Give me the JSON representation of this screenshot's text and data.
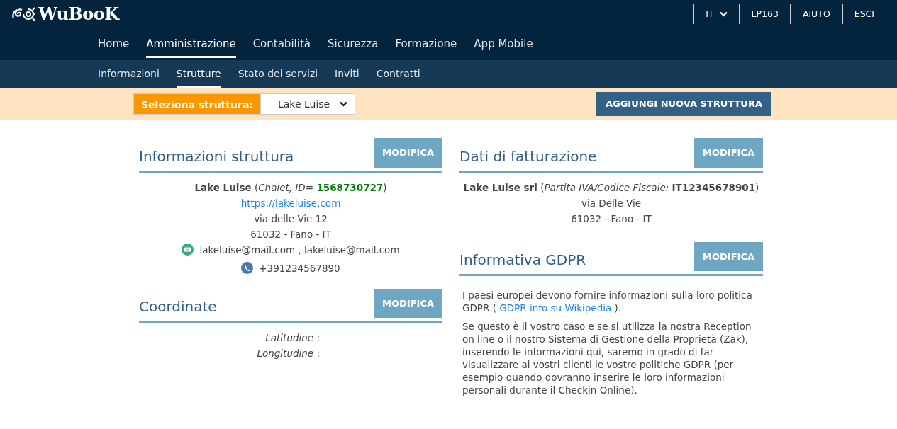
{
  "header": {
    "logo": "WuBooK",
    "top_links": [
      {
        "label": "IT",
        "kind": "dropdown"
      },
      {
        "label": "LP163",
        "kind": "link"
      },
      {
        "label": "AIUTO",
        "kind": "link"
      },
      {
        "label": "ESCI",
        "kind": "link"
      }
    ]
  },
  "main_nav": [
    {
      "label": "Home",
      "selected": false
    },
    {
      "label": "Amministrazione",
      "selected": true
    },
    {
      "label": "Contabilità",
      "selected": false
    },
    {
      "label": "Sicurezza",
      "selected": false
    },
    {
      "label": "Formazione",
      "selected": false
    },
    {
      "label": "App Mobile",
      "selected": false
    }
  ],
  "sub_nav": [
    {
      "label": "Informazioni",
      "selected": false
    },
    {
      "label": "Strutture",
      "selected": true
    },
    {
      "label": "Stato dei servizi",
      "selected": false
    },
    {
      "label": "Inviti",
      "selected": false
    },
    {
      "label": "Contratti",
      "selected": false
    }
  ],
  "toolbar": {
    "select_label": "Seleziona struttura:",
    "select_value": "Lake Luise",
    "add_button": "AGGIUNGI NUOVA STRUTTURA"
  },
  "structure_info": {
    "title": "Informazioni struttura",
    "button": "MODIFICA",
    "summary": "**Lake Luise** (*Chalet, ID=* **1568730727**)",
    "website": "https://lakeluise.com",
    "address": "via delle Vie 12",
    "city": "61032 - Fano - IT",
    "emails": "lakeluise@mail.com , lakeluise@mail.com",
    "phone": "+391234567890"
  },
  "coordinates": {
    "title": "Coordinate",
    "button": "MODIFICA",
    "rows": [
      {
        "label": "Latitudine",
        "separator": ":"
      },
      {
        "label": "Longitudine",
        "separator": ":"
      }
    ]
  },
  "billing": {
    "title": "Dati di fatturazione",
    "button": "MODIFICA",
    "summary": "**Lake Luise srl** (*Partita IVA/Codice Fiscale:* **IT12345678901**)",
    "address": "via Delle Vie",
    "city": "61032 - Fano - IT"
  },
  "gdpr": {
    "title": "Informativa GDPR",
    "button": "MODIFICA",
    "intro_before": "I paesi europei devono fornire informazioni sulla loro politica GDPR ( ",
    "link": "GDPR info su Wikipedia",
    "intro_after": " ).",
    "details": "Se questo è il vostro caso e se si utilizza la nostra Reception on line o il nostro Sistema di Gestione della Proprietà (Zak), inserendo le informazioni qui, saremo in grado di far visualizzare ai vostri clienti le vostre politiche GDPR (per esempio quando dovranno inserire le loro informazioni personali durante il Checkin Online)."
  }
}
